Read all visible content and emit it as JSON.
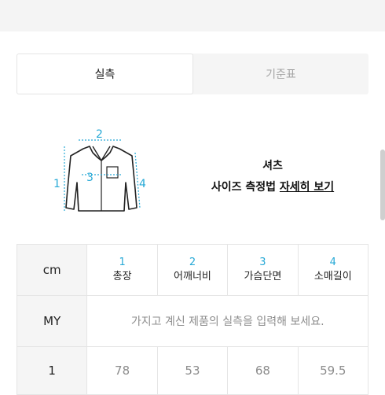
{
  "tabs": [
    {
      "label": "실측",
      "active": true
    },
    {
      "label": "기준표",
      "active": false
    }
  ],
  "illustration": {
    "type": "shirt",
    "markers": [
      "1",
      "2",
      "3",
      "4"
    ],
    "marker_color": "#27a9d6"
  },
  "description": {
    "category": "셔츠",
    "guide_prefix": "사이즈 측정법",
    "guide_link": "자세히 보기"
  },
  "table": {
    "unit": "cm",
    "columns": [
      {
        "num": "1",
        "label": "총장"
      },
      {
        "num": "2",
        "label": "어깨너비"
      },
      {
        "num": "3",
        "label": "가슴단면"
      },
      {
        "num": "4",
        "label": "소매길이"
      }
    ],
    "my_row": {
      "label": "MY",
      "prompt": "가지고 계신 제품의 실측을 입력해 보세요."
    },
    "rows": [
      {
        "size": "1",
        "values": [
          "78",
          "53",
          "68",
          "59.5"
        ]
      }
    ]
  },
  "colors": {
    "accent": "#27a9d6",
    "muted": "#8c8c8c",
    "header_bg": "#f5f5f5"
  }
}
